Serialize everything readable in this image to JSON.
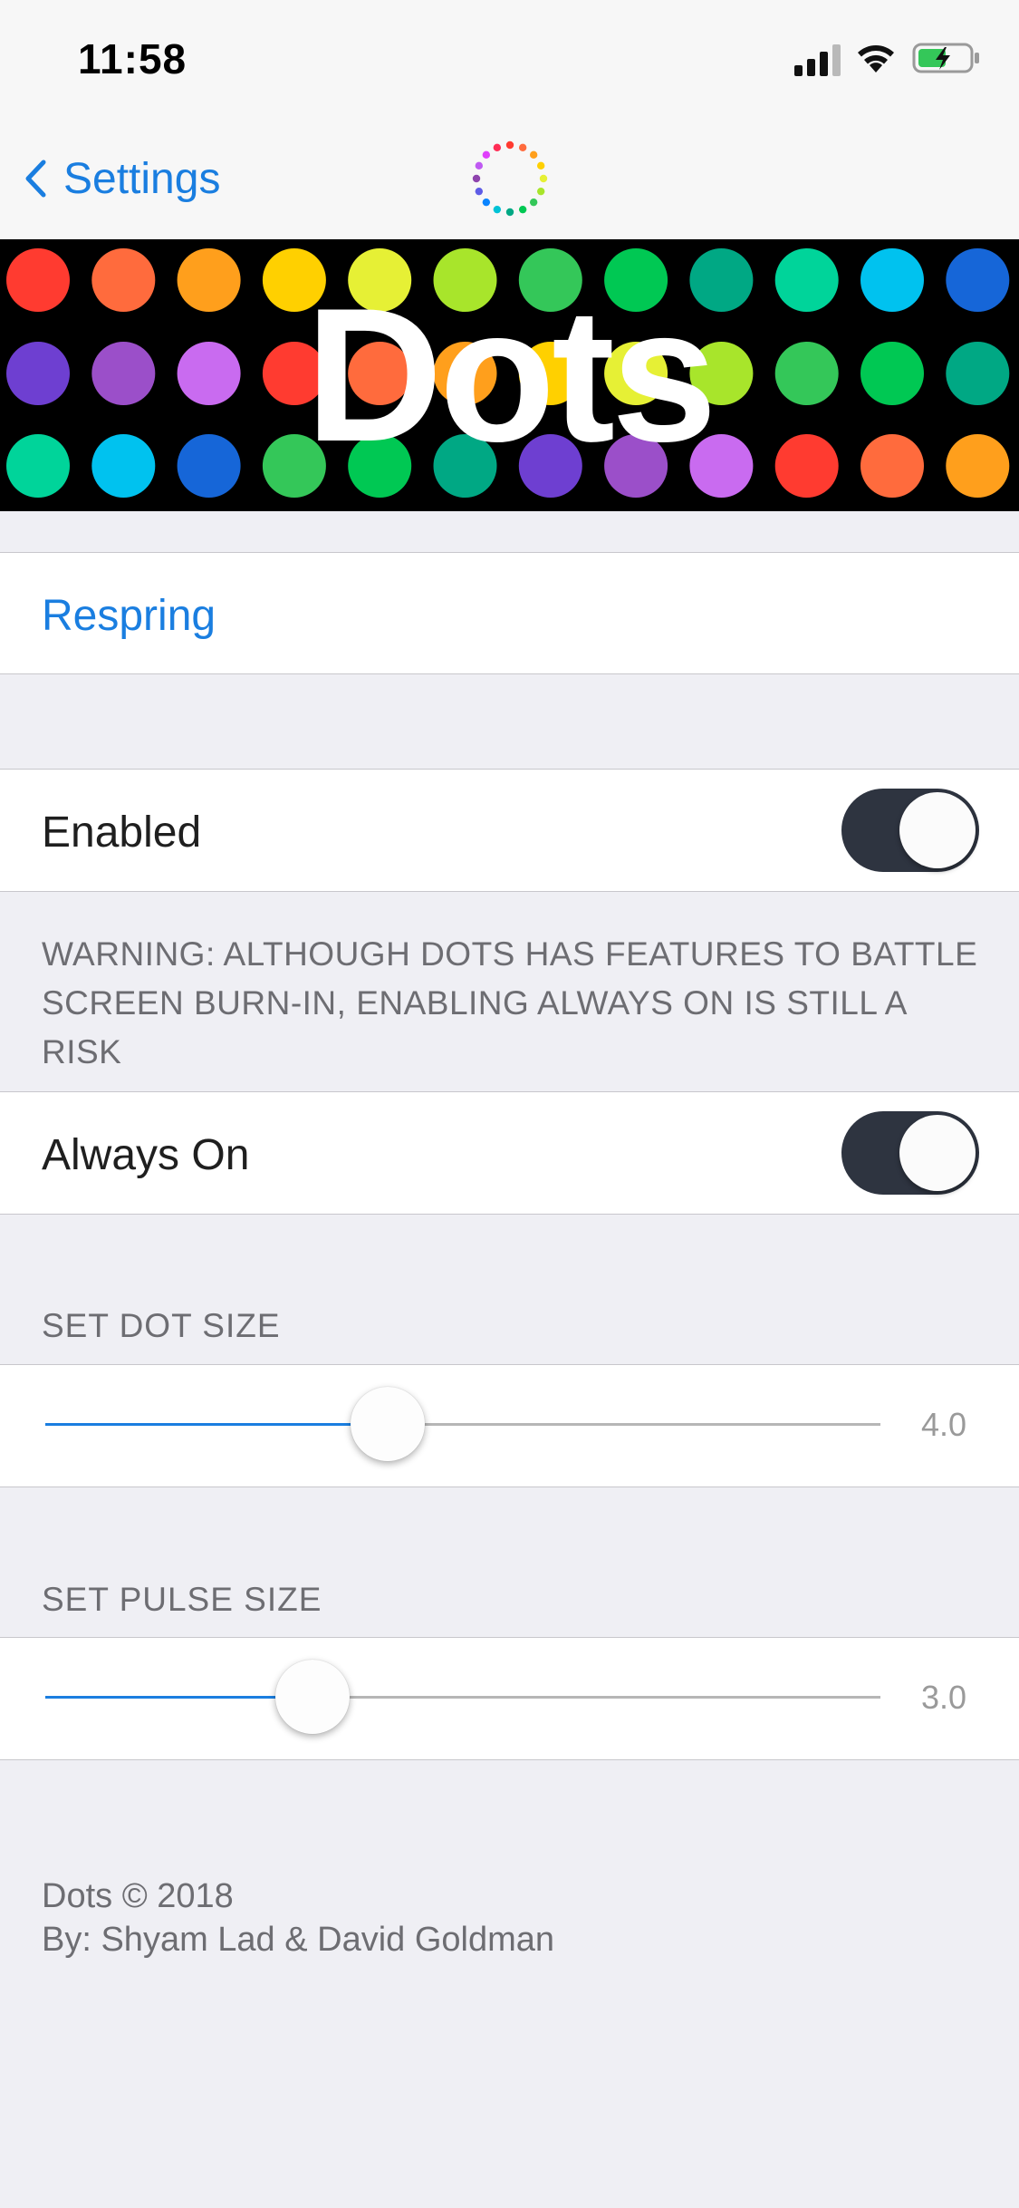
{
  "status_bar": {
    "time": "11:58"
  },
  "nav": {
    "back_label": "Settings",
    "logo_dot_colors": [
      "#ff3b30",
      "#ff6b3d",
      "#ff9f1c",
      "#ffd000",
      "#e6f035",
      "#a8e52b",
      "#34c759",
      "#00c853",
      "#00a884",
      "#00c2d6",
      "#0a84ff",
      "#5e5ce6",
      "#8e44ad",
      "#bf5af2",
      "#e040fb",
      "#ff2d55"
    ]
  },
  "banner": {
    "title": "Dots",
    "dot_rows": [
      [
        "#ff3b30",
        "#ff6b3d",
        "#ff9f1c",
        "#ffd000",
        "#e6f035",
        "#a8e52b",
        "#34c759",
        "#00c853",
        "#00a884",
        "#00d49a",
        "#00c2ef",
        "#1666d8"
      ],
      [
        "#6e3fd1",
        "#9b4fc9",
        "#c96bf0",
        "#ff3b30",
        "#ff6b3d",
        "#ff9f1c",
        "#ffd000",
        "#e6f035",
        "#a8e52b",
        "#34c759",
        "#00c853",
        "#00a884"
      ],
      [
        "#00d49a",
        "#00c2ef",
        "#1666d8",
        "#34c759",
        "#00c853",
        "#00a884",
        "#6e3fd1",
        "#9b4fc9",
        "#c96bf0",
        "#ff3b30",
        "#ff6b3d",
        "#ff9f1c"
      ]
    ]
  },
  "respring": {
    "label": "Respring"
  },
  "enabled": {
    "label": "Enabled",
    "on": true
  },
  "warning": {
    "text": "WARNING: ALTHOUGH DOTS HAS FEATURES TO BATTLE SCREEN BURN-IN, ENABLING ALWAYS ON IS STILL A RISK"
  },
  "always_on": {
    "label": "Always On",
    "on": true
  },
  "dot_size": {
    "header": "SET DOT SIZE",
    "value": "4.0",
    "fraction": 0.41
  },
  "pulse_size": {
    "header": "SET PULSE SIZE",
    "value": "3.0",
    "fraction": 0.32
  },
  "credits": {
    "line1": "Dots © 2018",
    "line2": "By: Shyam Lad & David Goldman"
  },
  "colors": {
    "accent": "#1a7ee0",
    "toggle_on": "#2e3440",
    "background": "#efeff4"
  }
}
